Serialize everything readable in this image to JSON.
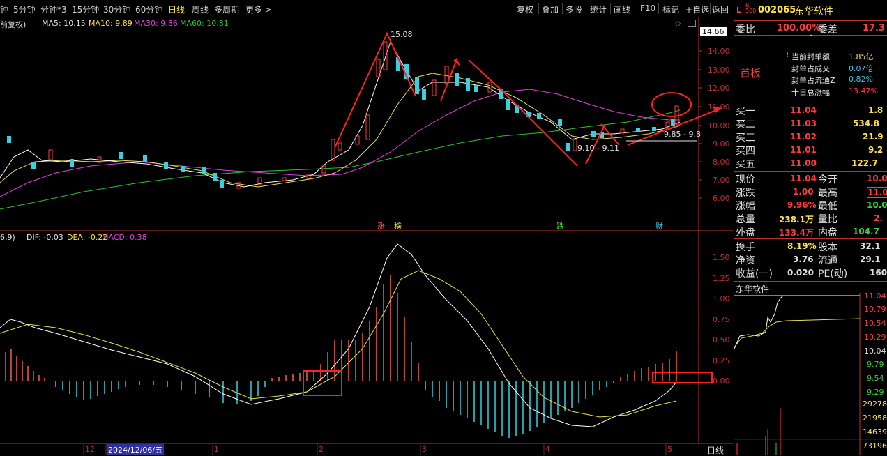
{
  "toolbar": {
    "periods": [
      "钟",
      "5分钟",
      "分钟*3",
      "15分钟",
      "30分钟",
      "60分钟",
      "日线",
      "周线",
      "多周期",
      "更多 >"
    ],
    "active_period": "日线",
    "tools": [
      "复权",
      "叠加",
      "多股",
      "统计",
      "画线",
      "F10",
      "标记",
      "+自选",
      "返回"
    ]
  },
  "ma_legend": {
    "prefix": "前复权)",
    "ma5": "MA5: 10.15",
    "ma10": "MA10: 9.89",
    "ma30": "MA30: 9.86",
    "ma60": "MA60: 10.81",
    "colors": {
      "ma5": "#ffffff",
      "ma10": "#e8e050",
      "ma30": "#e040e0",
      "ma60": "#30c030"
    }
  },
  "price_axis": {
    "current_tag": "14.66",
    "ticks": [
      "14.00",
      "13.00",
      "12.00",
      "11.00",
      "10.00",
      "9.00",
      "8.00",
      "7.00",
      "6.00"
    ]
  },
  "annotations": {
    "high": "15.08",
    "low_range": "9.10 - 9.11",
    "range2": "9.85 - 9.8",
    "markers": [
      "涨",
      "榜",
      "跌",
      "财"
    ]
  },
  "macd_legend": {
    "prefix": "6,9)",
    "dif": "DIF: -0.03",
    "dea": "DEA: -0.22",
    "macd": "MACD: 0.38"
  },
  "macd_axis": {
    "ticks": [
      "1.50",
      "1.25",
      "1.00",
      "0.75",
      "0.50",
      "0.25",
      "0.00"
    ]
  },
  "date_axis": {
    "labels": [
      "12",
      "2024/12/06/五",
      "1",
      "2",
      "3",
      "4",
      "5"
    ],
    "period_label": "日线"
  },
  "stock": {
    "flag": "L",
    "flag_sub": "R\n500",
    "code": "002065",
    "name": "东华软件",
    "weibi_label": "委比",
    "weibi_value": "100.00%",
    "weicha_label": "委差",
    "weicha_value": "17.3",
    "status": "首板",
    "seal_info": [
      {
        "label": "当前封单额",
        "value": "1.85亿"
      },
      {
        "label": "封单占成交",
        "value": "0.07倍"
      },
      {
        "label": "封单占流通Z",
        "value": "0.82%"
      },
      {
        "label": "十日总涨幅",
        "value": "13.47%"
      }
    ],
    "bids": [
      {
        "label": "买一",
        "price": "11.04",
        "vol": "1.8"
      },
      {
        "label": "买二",
        "price": "11.03",
        "vol": "534.8"
      },
      {
        "label": "买三",
        "price": "11.02",
        "vol": "21.9"
      },
      {
        "label": "买四",
        "price": "11.01",
        "vol": "9.2"
      },
      {
        "label": "买五",
        "price": "11.00",
        "vol": "122.7"
      }
    ],
    "quote": [
      {
        "l1": "现价",
        "v1": "11.04",
        "l2": "今开",
        "v2": "10.0"
      },
      {
        "l1": "涨跌",
        "v1": "1.00",
        "l2": "最高",
        "v2": "11.0"
      },
      {
        "l1": "涨幅",
        "v1": "9.96%",
        "l2": "最低",
        "v2": "10.0"
      },
      {
        "l1": "总量",
        "v1": "238.1万",
        "l2": "量比",
        "v2": "2."
      },
      {
        "l1": "外盘",
        "v1": "133.4万",
        "l2": "内盘",
        "v2": "104.7"
      }
    ],
    "quote2": [
      {
        "l1": "换手",
        "v1": "8.19%",
        "l2": "股本",
        "v2": "32.1"
      },
      {
        "l1": "净资",
        "v1": "3.76",
        "l2": "流通",
        "v2": "29.1"
      },
      {
        "l1": "收益(一)",
        "v1": "0.020",
        "l2": "PE(动)",
        "v2": "160"
      }
    ],
    "mini_title": "东华软件",
    "mini_axis": [
      "11.04",
      "10.79",
      "10.54",
      "10.29",
      "10.04",
      "9.79",
      "9.54",
      "9.29"
    ],
    "vol_axis": [
      "29278",
      "21958",
      "14639",
      "73196"
    ]
  }
}
